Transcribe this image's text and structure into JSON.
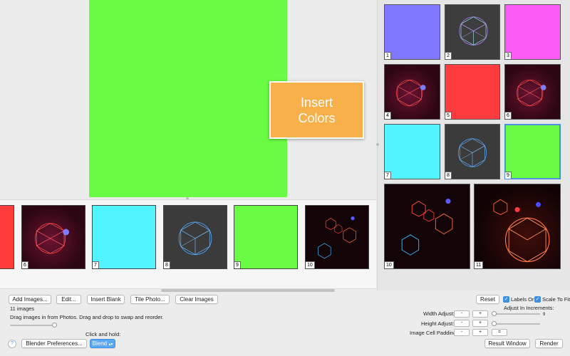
{
  "overlay": {
    "label_line1": "Insert",
    "label_line2": "Colors"
  },
  "strip": {
    "items": [
      {
        "number": "",
        "kind": "color",
        "color": "#ff3c3c"
      },
      {
        "number": "6",
        "kind": "geo-red-sphere"
      },
      {
        "number": "7",
        "kind": "color",
        "color": "#52f5ff"
      },
      {
        "number": "8",
        "kind": "geo-blue-dark"
      },
      {
        "number": "9",
        "kind": "color",
        "color": "#6afc45"
      },
      {
        "number": "10",
        "kind": "geo-multi"
      }
    ]
  },
  "grid": {
    "cells": [
      {
        "number": "1",
        "color": "#7f78ff"
      },
      {
        "number": "2",
        "kind": "geo-cyan-sphere"
      },
      {
        "number": "3",
        "color": "#fb5cf6"
      },
      {
        "number": "4",
        "kind": "geo-red-sphere"
      },
      {
        "number": "5",
        "color": "#fe3c3d"
      },
      {
        "number": "6",
        "kind": "geo-red-sphere"
      },
      {
        "number": "7",
        "color": "#52f5ff"
      },
      {
        "number": "8",
        "kind": "geo-blue-dark"
      },
      {
        "number": "9",
        "color": "#6afc45"
      },
      {
        "number": "10",
        "kind": "geo-multi"
      },
      {
        "number": "11",
        "kind": "geo-orange"
      }
    ]
  },
  "preview": {
    "color": "#6afc45"
  },
  "toolbar": {
    "add_images": "Add Images...",
    "edit": "Edit...",
    "insert_blank": "Insert Blank",
    "tile_photo": "Tile Photo...",
    "clear_images": "Clear Images",
    "reset": "Reset",
    "labels_on": "Labels On",
    "scale_to_fit": "Scale To Fit"
  },
  "info": {
    "count": "11 images",
    "hint": "Drag images in from Photos. Drag and drop to swap and reorder.",
    "click_and_hold": "Click and hold:"
  },
  "adjust": {
    "in_increments": "Adjust In Increments:",
    "width_label": "Width Adjust:",
    "height_label": "Height Adjust:",
    "padding_label": "Image Cell Padding:",
    "minus": "-",
    "plus": "+",
    "equals": "=",
    "increment_value": "9"
  },
  "footer": {
    "help": "?",
    "blender_prefs": "Blender Preferences...",
    "blend": "Blend",
    "result_window": "Result Window",
    "render": "Render"
  }
}
